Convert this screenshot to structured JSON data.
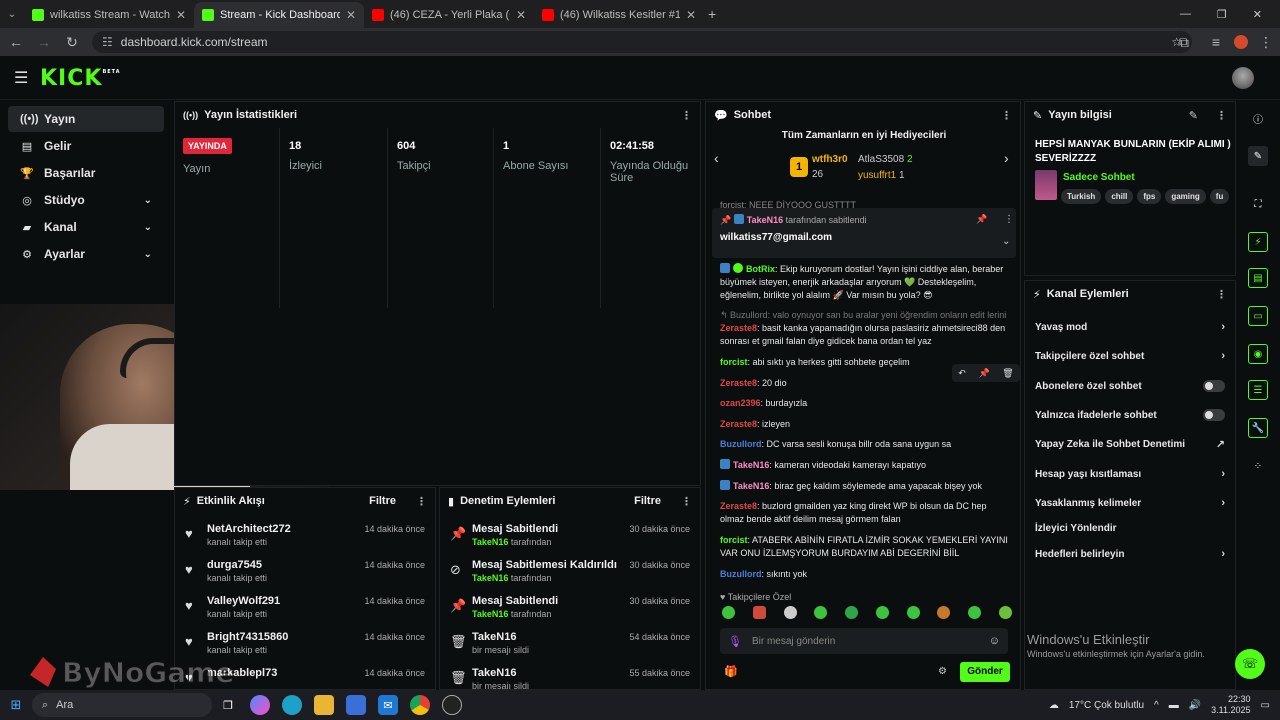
{
  "browser": {
    "tabs": [
      {
        "title": "wilkatiss Stream - Watch Live o",
        "color": "#53fc18"
      },
      {
        "title": "Stream - Kick Dashboard",
        "color": "#53fc18"
      },
      {
        "title": "(46) CEZA - Yerli Plaka (Official",
        "color": "#ff0000"
      },
      {
        "title": "(46) Wilkatiss Kesitler #1 - YouT",
        "color": "#ff0000"
      }
    ],
    "url": "dashboard.kick.com/stream"
  },
  "header": {
    "logo": "KICK",
    "beta": "BETA"
  },
  "sidebar": {
    "items": [
      {
        "label": "Yayın",
        "icon": "radio-icon"
      },
      {
        "label": "Gelir",
        "icon": "money-icon"
      },
      {
        "label": "Başarılar",
        "icon": "trophy-icon"
      },
      {
        "label": "Stüdyo",
        "icon": "studio-icon"
      },
      {
        "label": "Kanal",
        "icon": "channel-icon"
      },
      {
        "label": "Ayarlar",
        "icon": "gear-icon"
      }
    ]
  },
  "stats": {
    "title": "Yayın İstatistikleri",
    "live_badge": "YAYINDA",
    "live_label": "Yayın",
    "items": [
      {
        "value": "18",
        "label": "İzleyici"
      },
      {
        "value": "604",
        "label": "Takipçi"
      },
      {
        "value": "1",
        "label": "Abone Sayısı"
      },
      {
        "value": "02:41:58",
        "label": "Yayında Olduğu Süre"
      }
    ]
  },
  "activity": {
    "title": "Etkinlik Akışı",
    "filter": "Filtre",
    "rows": [
      {
        "name": "NetArchitect272",
        "sub": "kanalı takip etti",
        "time": "14 dakika önce"
      },
      {
        "name": "durga7545",
        "sub": "kanalı takip etti",
        "time": "14 dakika önce"
      },
      {
        "name": "ValleyWolf291",
        "sub": "kanalı takip etti",
        "time": "14 dakika önce"
      },
      {
        "name": "Bright74315860",
        "sub": "kanalı takip etti",
        "time": "14 dakika önce"
      },
      {
        "name": "markablepl73",
        "sub": "",
        "time": "14 dakika önce"
      }
    ]
  },
  "moderation": {
    "title": "Denetim Eylemleri",
    "filter": "Filtre",
    "rows": [
      {
        "name": "Mesaj Sabitlendi",
        "user": "TakeN16",
        "by": "tarafından",
        "time": "30 dakika önce"
      },
      {
        "name": "Mesaj Sabitlemesi Kaldırıldı",
        "user": "TakeN16",
        "by": "tarafından",
        "time": "30 dakika önce"
      },
      {
        "name": "Mesaj Sabitlendi",
        "user": "TakeN16",
        "by": "tarafından",
        "time": "30 dakika önce"
      },
      {
        "name": "TakeN16",
        "user": "",
        "by": "bir mesajı sildi",
        "time": "54 dakika önce"
      },
      {
        "name": "TakeN16",
        "user": "",
        "by": "bir mesajı sildi",
        "time": "55 dakika önce"
      }
    ]
  },
  "chat": {
    "title": "Sohbet",
    "gifters_title": "Tüm Zamanların en iyi Hediyecileri",
    "gifters": [
      {
        "name": "wtfh3r0",
        "count": "26"
      },
      {
        "name": "AtlaS3508",
        "count": "2"
      },
      {
        "name": "yusuffrt1",
        "count": "1"
      }
    ],
    "top_cut": "forcist: NEEE DİYOOO GUSTTTT",
    "pinned_by": "TakeN16",
    "pinned_suffix": "tarafından sabitlendi",
    "pinned_text": "wilkatiss77@gmail.com",
    "messages": [
      {
        "user": "BotRix",
        "text": "Ekip kuruyorum dostlar! Yayın işini ciddiye alan, beraber büyümek isteyen, enerjik arkadaşlar arıyorum 💚 Destekleşelim, eğlenelim, birlikte yol alalım 🚀 Var mısın bu yola? 😎"
      },
      {
        "reply": "Buzullord: valo oynuyor san bu aralar yeni öğrendim onların edit lerini ..."
      },
      {
        "user": "Zeraste8",
        "text": "basit kanka yapamadığın olursa paslasiriz ahmetsireci88 den sonrası et gmail falan diye gidicek bana ordan tel yaz"
      },
      {
        "user": "forcist",
        "text": "abi sıktı ya herkes gitti sohbete geçelim"
      },
      {
        "user": "Zeraste8",
        "text": "20 dio"
      },
      {
        "user": "ozan2396",
        "text": "burdayızla"
      },
      {
        "user": "Zeraste8",
        "text": "izleyen"
      },
      {
        "user": "Buzullord",
        "text": "DC varsa sesli konuşa billr oda sana uygun sa"
      },
      {
        "user": "TakeN16",
        "text": "kameran videodaki kamerayı kapatıyo"
      },
      {
        "user": "TakeN16",
        "text": "biraz geç kaldım söylemede ama yapacak bişey yok"
      },
      {
        "user": "Zeraste8",
        "text": "buzlord gmailden yaz king direkt WP bi olsun da DC hep olmaz bende aktif deilim mesaj görmem falan"
      },
      {
        "user": "forcist",
        "text": "ATABERK ABİNİN FIRATLA İZMİR SOKAK YEMEKLERİ YAYINI VAR ONU İZLEMŞYORUM BURDAYIM ABİ DEGERİNİ BİİL"
      },
      {
        "user": "Buzullord",
        "text": "sıkıntı yok"
      }
    ],
    "follower_only": "Takipçilere Özel",
    "input_placeholder": "Bir mesaj gönderin",
    "send": "Gönder"
  },
  "stream_info": {
    "title": "Yayın bilgisi",
    "stream_title": "HEPSİ MANYAK BUNLARIN (EKİP ALIMI ) SEVERİZZZZ",
    "category": "Sadece Sohbet",
    "tags": [
      "Turkish",
      "chill",
      "fps",
      "gaming",
      "fu"
    ]
  },
  "channel_actions": {
    "title": "Kanal Eylemleri",
    "items": [
      {
        "label": "Yavaş mod",
        "kind": "arrow"
      },
      {
        "label": "Takipçilere özel sohbet",
        "kind": "arrow"
      },
      {
        "label": "Abonelere özel sohbet",
        "kind": "toggle"
      },
      {
        "label": "Yalnızca ifadelerle sohbet",
        "kind": "toggle"
      },
      {
        "label": "Yapay Zeka ile Sohbet Denetimi",
        "kind": "external"
      },
      {
        "label": "Hesap yaşı kısıtlaması",
        "kind": "arrow"
      },
      {
        "label": "Yasaklanmış kelimeler",
        "kind": "arrow"
      },
      {
        "label": "İzleyici Yönlendir",
        "kind": "none"
      },
      {
        "label": "Hedefleri belirleyin",
        "kind": "arrow"
      }
    ]
  },
  "windows": {
    "activate_title": "Windows'u Etkinleştir",
    "activate_sub": "Windows'u etkinleştirmek için Ayarlar'a gidin.",
    "search": "Ara",
    "weather": "17°C  Çok bulutlu",
    "time": "22:30",
    "date": "3.11.2025"
  },
  "watermark": "ByNoGame"
}
